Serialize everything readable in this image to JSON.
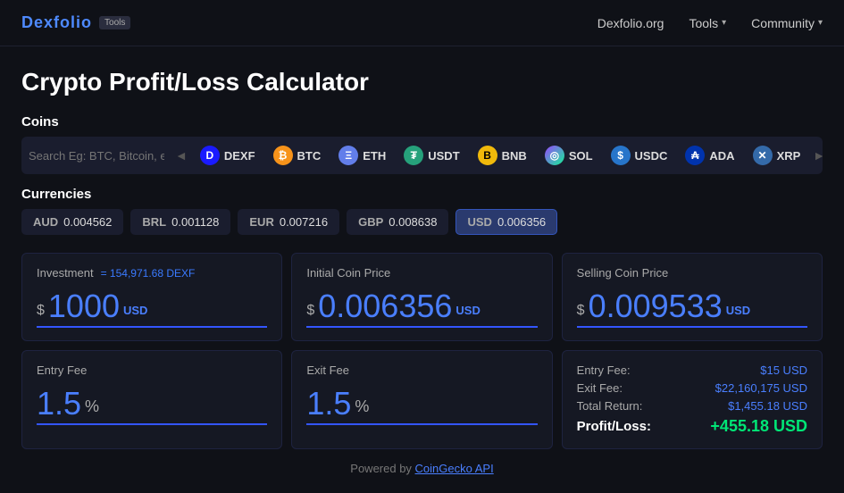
{
  "nav": {
    "logo_main": "Dexfolio",
    "logo_accent": "",
    "tools_badge": "Tools",
    "links": [
      {
        "id": "dexfolio-org",
        "label": "Dexfolio.org",
        "has_dropdown": false
      },
      {
        "id": "tools",
        "label": "Tools",
        "has_dropdown": true
      },
      {
        "id": "community",
        "label": "Community",
        "has_dropdown": true
      }
    ]
  },
  "page": {
    "title": "Crypto Profit/Loss Calculator"
  },
  "coins_section": {
    "label": "Coins",
    "search_placeholder": "Search Eg: BTC, Bitcoin, etc.",
    "coins": [
      {
        "id": "dexf",
        "symbol": "DEXF",
        "icon_char": "D",
        "icon_class": "icon-dexf"
      },
      {
        "id": "btc",
        "symbol": "BTC",
        "icon_char": "₿",
        "icon_class": "icon-btc"
      },
      {
        "id": "eth",
        "symbol": "ETH",
        "icon_char": "Ξ",
        "icon_class": "icon-eth"
      },
      {
        "id": "usdt",
        "symbol": "USDT",
        "icon_char": "₮",
        "icon_class": "icon-usdt"
      },
      {
        "id": "bnb",
        "symbol": "BNB",
        "icon_char": "B",
        "icon_class": "icon-bnb"
      },
      {
        "id": "sol",
        "symbol": "SOL",
        "icon_char": "◎",
        "icon_class": "icon-sol"
      },
      {
        "id": "usdc",
        "symbol": "USDC",
        "icon_char": "$",
        "icon_class": "icon-usdc"
      },
      {
        "id": "ada",
        "symbol": "ADA",
        "icon_char": "₳",
        "icon_class": "icon-ada"
      },
      {
        "id": "xrp",
        "symbol": "XRP",
        "icon_char": "✕",
        "icon_class": "icon-xrp"
      }
    ]
  },
  "currencies_section": {
    "label": "Currencies",
    "currencies": [
      {
        "id": "aud",
        "code": "AUD",
        "value": "0.004562",
        "active": false
      },
      {
        "id": "brl",
        "code": "BRL",
        "value": "0.001128",
        "active": false
      },
      {
        "id": "eur",
        "code": "EUR",
        "value": "0.007216",
        "active": false
      },
      {
        "id": "gbp",
        "code": "GBP",
        "value": "0.008638",
        "active": false
      },
      {
        "id": "usd",
        "code": "USD",
        "value": "0.006356",
        "active": true
      }
    ]
  },
  "calculator": {
    "investment": {
      "label": "Investment",
      "hint": "= 154,971.68 DEXF",
      "dollar_sign": "$",
      "value": "1000",
      "unit": "USD"
    },
    "initial_price": {
      "label": "Initial Coin Price",
      "dollar_sign": "$",
      "value": "0.006356",
      "unit": "USD"
    },
    "selling_price": {
      "label": "Selling Coin Price",
      "dollar_sign": "$",
      "value": "0.009533",
      "unit": "USD"
    },
    "entry_fee": {
      "label": "Entry Fee",
      "value": "1.5",
      "unit": "%"
    },
    "exit_fee": {
      "label": "Exit Fee",
      "value": "1.5",
      "unit": "%"
    },
    "results": {
      "entry_fee_label": "Entry Fee:",
      "entry_fee_value": "$15 USD",
      "exit_fee_label": "Exit Fee:",
      "exit_fee_value": "$22,160,175 USD",
      "total_return_label": "Total Return:",
      "total_return_value": "$1,455.18 USD",
      "profit_loss_label": "Profit/Loss:",
      "profit_loss_value": "+455.18 USD"
    }
  },
  "footer": {
    "text": "Powered by ",
    "link_text": "CoinGecko API"
  }
}
